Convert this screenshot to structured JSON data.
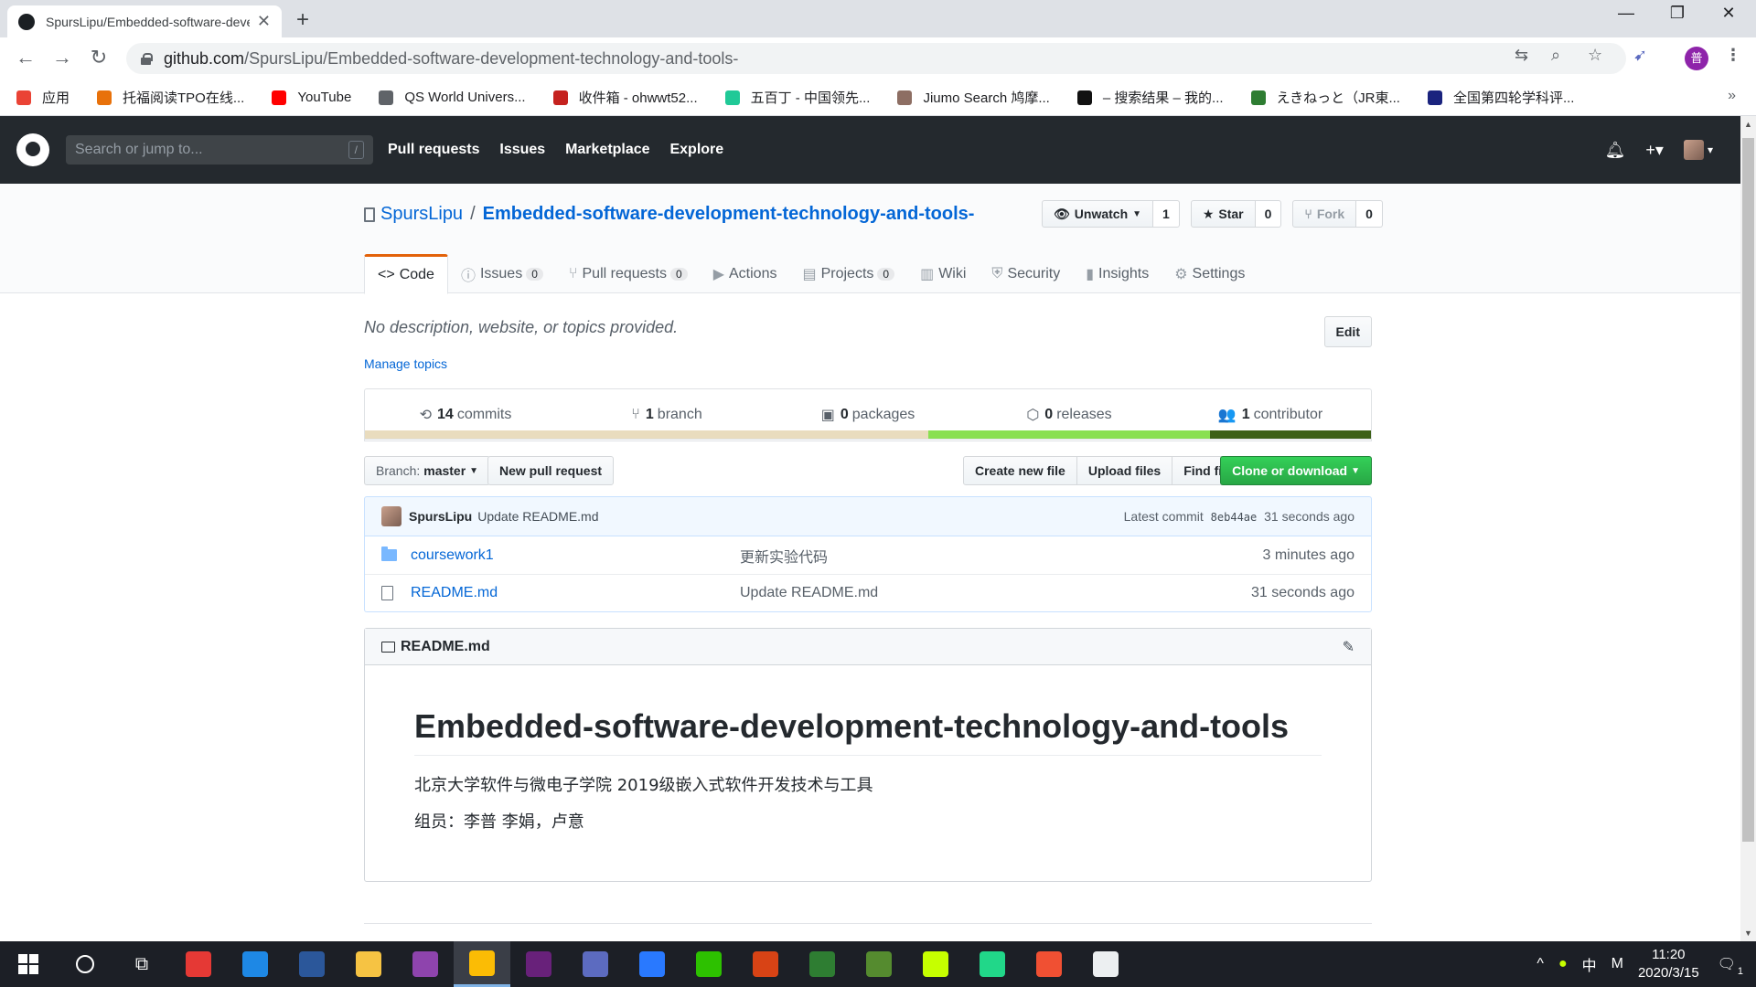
{
  "browser": {
    "tab_title": "SpursLipu/Embedded-software-development-technology-and-tools-",
    "url_domain": "github.com",
    "url_path": "/SpursLipu/Embedded-software-development-technology-and-tools-",
    "profile_initial": "普",
    "bookmarks": [
      {
        "label": "应用",
        "color": "#ea4335"
      },
      {
        "label": "托福阅读TPO在线...",
        "color": "#e8710a"
      },
      {
        "label": "YouTube",
        "color": "#ff0000"
      },
      {
        "label": "QS World Univers...",
        "color": "#5f6368"
      },
      {
        "label": "收件箱 - ohwwt52...",
        "color": "#c5221f"
      },
      {
        "label": "五百丁 - 中国领先...",
        "color": "#20c997"
      },
      {
        "label": "Jiumo Search 鸠摩...",
        "color": "#8d6e63"
      },
      {
        "label": "– 搜索结果 – 我的...",
        "color": "#111111"
      },
      {
        "label": "えきねっと（JR東...",
        "color": "#2e7d32"
      },
      {
        "label": "全国第四轮学科评...",
        "color": "#1a237e"
      }
    ],
    "bookmarks_more": "»"
  },
  "github": {
    "search_placeholder": "Search or jump to...",
    "search_shortcut": "/",
    "nav": [
      "Pull requests",
      "Issues",
      "Marketplace",
      "Explore"
    ]
  },
  "repo": {
    "owner": "SpursLipu",
    "separator": "/",
    "name": "Embedded-software-development-technology-and-tools-",
    "watch_label": "Unwatch",
    "watch_count": "1",
    "star_label": "Star",
    "star_count": "0",
    "fork_label": "Fork",
    "fork_count": "0",
    "tabs": [
      {
        "label": "Code",
        "icon": "<>",
        "count": ""
      },
      {
        "label": "Issues",
        "icon": "ⓘ",
        "count": "0"
      },
      {
        "label": "Pull requests",
        "icon": "⑂",
        "count": "0"
      },
      {
        "label": "Actions",
        "icon": "▶",
        "count": ""
      },
      {
        "label": "Projects",
        "icon": "▤",
        "count": "0"
      },
      {
        "label": "Wiki",
        "icon": "▥",
        "count": ""
      },
      {
        "label": "Security",
        "icon": "⛨",
        "count": ""
      },
      {
        "label": "Insights",
        "icon": "▮",
        "count": ""
      },
      {
        "label": "Settings",
        "icon": "⚙",
        "count": ""
      }
    ],
    "description": "No description, website, or topics provided.",
    "edit_label": "Edit",
    "manage_topics": "Manage topics",
    "summary": [
      {
        "num": "14",
        "label": "commits",
        "icon": "⟲"
      },
      {
        "num": "1",
        "label": "branch",
        "icon": "⑂"
      },
      {
        "num": "0",
        "label": "packages",
        "icon": "▣"
      },
      {
        "num": "0",
        "label": "releases",
        "icon": "⬡"
      },
      {
        "num": "1",
        "label": "contributor",
        "icon": "👥"
      }
    ],
    "language_colors": [
      "#e9dcbe",
      "#89e051",
      "#3d6117"
    ],
    "language_shares": [
      0.56,
      0.28,
      0.16
    ],
    "branch_prefix": "Branch:",
    "branch_name": "master",
    "new_pr": "New pull request",
    "create_file": "Create new file",
    "upload_files": "Upload files",
    "find_file": "Find file",
    "clone": "Clone or download",
    "latest_commit": {
      "author": "SpursLipu",
      "message": "Update README.md",
      "prefix": "Latest commit",
      "sha": "8eb44ae",
      "age": "31 seconds ago"
    },
    "files": [
      {
        "type": "folder",
        "name": "coursework1",
        "message": "更新实验代码",
        "age": "3 minutes ago"
      },
      {
        "type": "file",
        "name": "README.md",
        "message": "Update README.md",
        "age": "31 seconds ago"
      }
    ],
    "readme": {
      "filename": "README.md",
      "title": "Embedded-software-development-technology-and-tools",
      "line1": "北京大学软件与微电子学院 2019级嵌入式软件开发技术与工具",
      "line2": "组员：李普 李娟，卢意"
    }
  },
  "taskbar": {
    "apps": [
      {
        "name": "youdao-icon",
        "color": "#e53935"
      },
      {
        "name": "edge-icon",
        "color": "#1e88e5"
      },
      {
        "name": "word-icon",
        "color": "#2b579a"
      },
      {
        "name": "file-explorer-icon",
        "color": "#f6c343"
      },
      {
        "name": "app-purple-icon",
        "color": "#8e44ad"
      },
      {
        "name": "chrome-icon",
        "color": "#fbbc05",
        "active": true
      },
      {
        "name": "visual-studio-icon",
        "color": "#68217a"
      },
      {
        "name": "app-blue-icon",
        "color": "#5c6bc0"
      },
      {
        "name": "app-circle-icon",
        "color": "#2979ff"
      },
      {
        "name": "wechat-icon",
        "color": "#2dc100"
      },
      {
        "name": "app-red-icon",
        "color": "#d84315"
      },
      {
        "name": "app-s-icon",
        "color": "#2e7d32"
      },
      {
        "name": "app-green-icon",
        "color": "#558b2f"
      },
      {
        "name": "app-yellow-icon",
        "color": "#c6ff00"
      },
      {
        "name": "pycharm-icon",
        "color": "#21d789"
      },
      {
        "name": "git-icon",
        "color": "#f05033"
      },
      {
        "name": "notepad-icon",
        "color": "#eceff1"
      }
    ],
    "ime": "中",
    "ime2": "M",
    "time": "11:20",
    "date": "2020/3/15",
    "notifications": "1"
  }
}
